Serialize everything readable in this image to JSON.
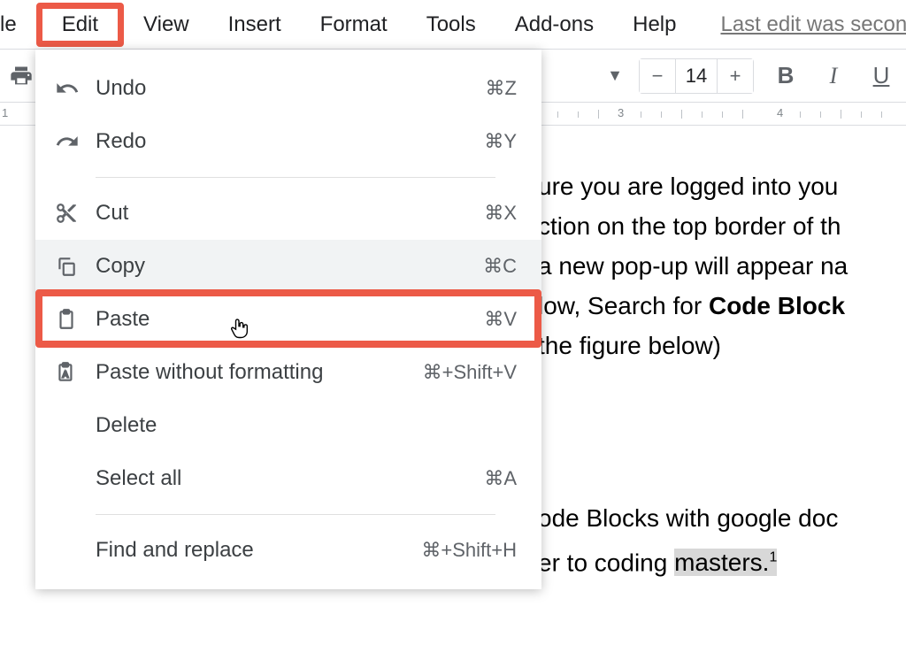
{
  "menubar": {
    "file_trunc": "le",
    "edit": "Edit",
    "view": "View",
    "insert": "Insert",
    "format": "Format",
    "tools": "Tools",
    "addons": "Add-ons",
    "help": "Help",
    "last_edit": "Last edit was seconds ago"
  },
  "toolbar": {
    "font_size": "14",
    "minus": "−",
    "plus": "+",
    "bold": "B",
    "italic": "I",
    "underline": "U"
  },
  "ruler": {
    "num_1_trunc": "1",
    "num_3": "3",
    "num_4": "4"
  },
  "edit_menu": {
    "undo": {
      "label": "Undo",
      "shortcut": "⌘Z"
    },
    "redo": {
      "label": "Redo",
      "shortcut": "⌘Y"
    },
    "cut": {
      "label": "Cut",
      "shortcut": "⌘X"
    },
    "copy": {
      "label": "Copy",
      "shortcut": "⌘C"
    },
    "paste": {
      "label": "Paste",
      "shortcut": "⌘V"
    },
    "paste_nofmt": {
      "label": "Paste without formatting",
      "shortcut": "⌘+Shift+V"
    },
    "delete": {
      "label": "Delete",
      "shortcut": ""
    },
    "select_all": {
      "label": "Select all",
      "shortcut": "⌘A"
    },
    "find_replace": {
      "label": "Find and replace",
      "shortcut": "⌘+Shift+H"
    }
  },
  "document": {
    "line1": "ure you are logged into you",
    "line2": "ction on the top border of th",
    "line3a": "a new pop-up will appear na",
    "line4a": "low, Search for ",
    "line4b": "Code Block",
    "line5": "the figure below)",
    "para2a": "ode Blocks with google doc",
    "para2b": "er to coding ",
    "para2c": "masters.",
    "sup": "1"
  }
}
